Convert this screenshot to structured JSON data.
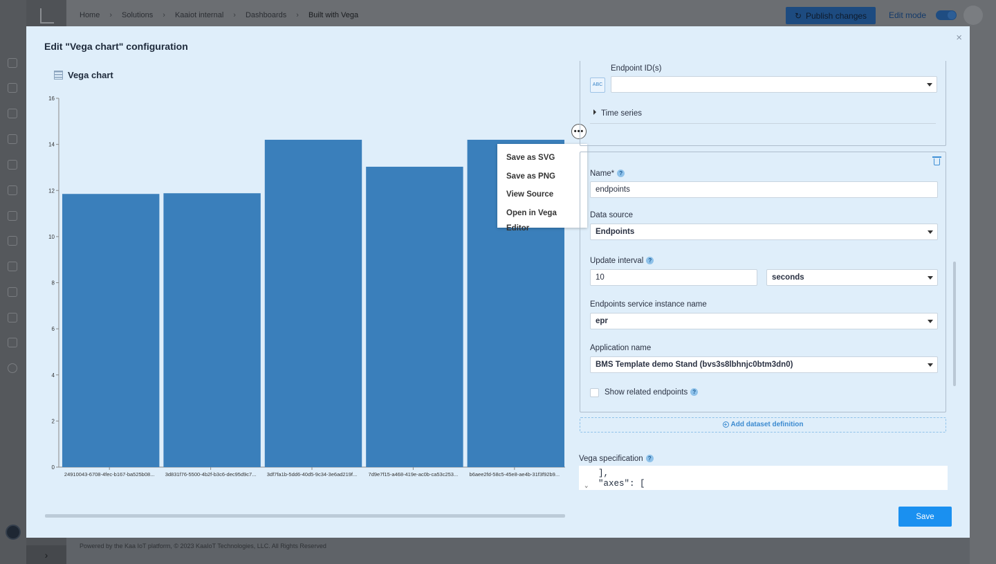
{
  "breadcrumbs": [
    "Home",
    "Solutions",
    "Kaaiot internal",
    "Dashboards",
    "Built with Vega"
  ],
  "header": {
    "publish_label": "Publish changes",
    "edit_mode_label": "Edit mode"
  },
  "footer": "Powered by the Kaa IoT platform, © 2023 KaaIoT Technologies, LLC. All Rights Reserved",
  "modal": {
    "title": "Edit \"Vega chart\" configuration",
    "close": "×",
    "save_label": "Save"
  },
  "chart_panel": {
    "title": "Vega chart",
    "more_label": "•••",
    "menu": [
      "Save as SVG",
      "Save as PNG",
      "View Source",
      "Open in Vega Editor"
    ]
  },
  "chart_data": {
    "type": "bar",
    "categories": [
      "24910043-6708-4fec-b167-ba525b08...",
      "3d831f76-5500-4b2f-b3c6-dec95d9c7...",
      "3df7fa1b-5dd6-40d5-9c34-3e6ad219f...",
      "7d9e7f15-a468-419e-ac0b-ca53c253...",
      "b6aee2fd-58c5-45e8-ae4b-31f3f92b9..."
    ],
    "values": [
      11.85,
      11.88,
      14.2,
      13.03,
      14.2
    ],
    "ylim": [
      0,
      16
    ],
    "yticks": [
      "0",
      "2",
      "4",
      "6",
      "8",
      "10",
      "12",
      "14",
      "16"
    ],
    "color": "#3a7fbb",
    "grid": false
  },
  "config": {
    "endpoint_ids_label": "Endpoint ID(s)",
    "endpoint_ids_value": "",
    "abc_badge": "ABC",
    "time_series_label": "Time series",
    "name_label": "Name*",
    "name_value": "endpoints",
    "data_source_label": "Data source",
    "data_source_value": "Endpoints",
    "update_interval_label": "Update interval",
    "update_interval_value": "10",
    "update_interval_unit": "seconds",
    "eps_instance_label": "Endpoints service instance name",
    "eps_instance_value": "epr",
    "application_label": "Application name",
    "application_value": "BMS Template demo Stand (bvs3s8lbhnjc0btm3dn0)",
    "show_related_label": "Show related endpoints",
    "add_dataset_label": "Add dataset definition",
    "vega_spec_label": "Vega specification",
    "help": "?",
    "code_lines": [
      "],",
      "\"axes\": ["
    ]
  }
}
